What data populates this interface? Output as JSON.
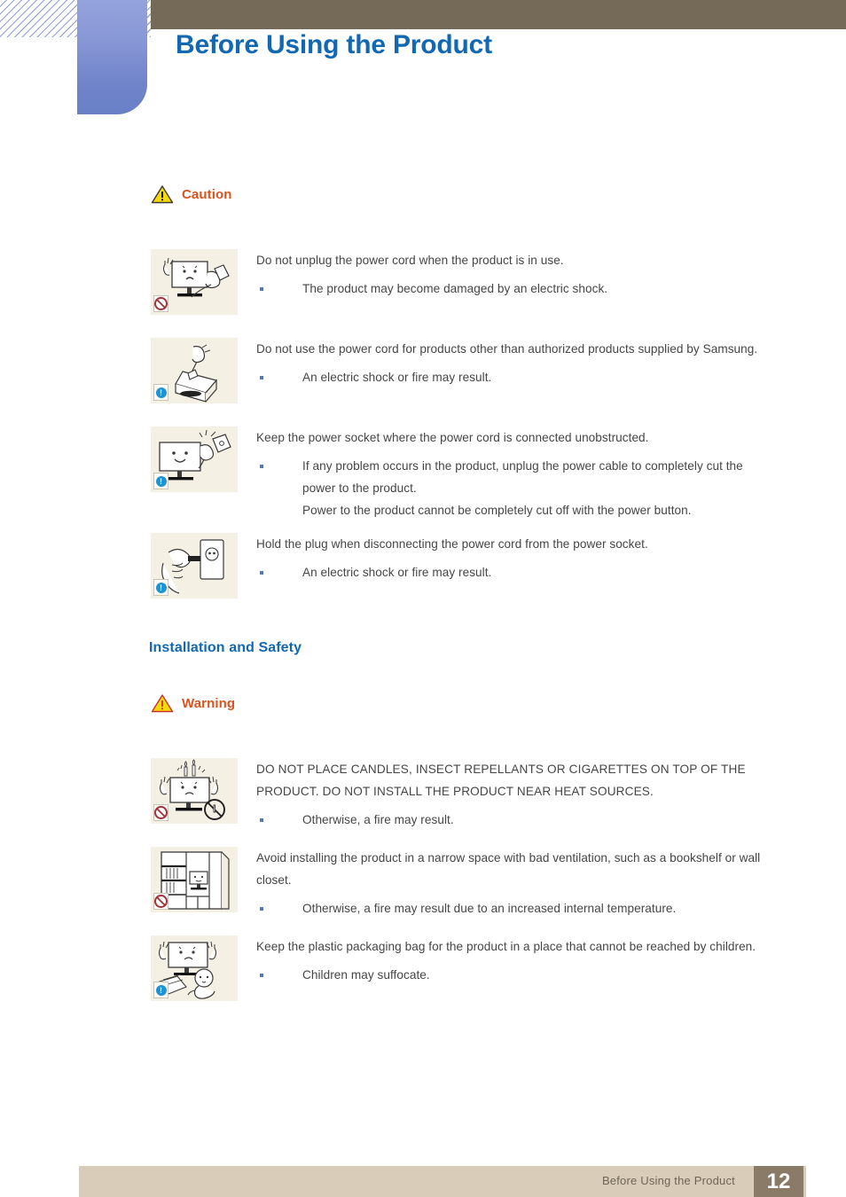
{
  "header": {
    "title": "Before Using the Product"
  },
  "notices": {
    "caution_label": "Caution",
    "warning_label": "Warning"
  },
  "sections": [
    {
      "heading": null,
      "notice": "Caution",
      "items": [
        {
          "illustration": "monitor-unplug-cord-illustration",
          "badge": "prohibition-icon",
          "lead": "Do not unplug the power cord when the product is in use.",
          "bullets": [
            "The product may become damaged by an electric shock."
          ]
        },
        {
          "illustration": "samsung-box-power-cord-illustration",
          "badge": "info-icon",
          "lead": "Do not use the power cord for products other than authorized products supplied by Samsung.",
          "bullets": [
            "An electric shock or fire may result."
          ]
        },
        {
          "illustration": "monitor-power-socket-illustration",
          "badge": "info-icon",
          "lead": "Keep the power socket where the power cord is connected unobstructed.",
          "bullets": [
            "If any problem occurs in the product, unplug the power cable to completely cut the power to the product.",
            "Power to the product cannot be completely cut off with the power button."
          ]
        },
        {
          "illustration": "hand-holding-plug-illustration",
          "badge": "info-icon",
          "lead": "Hold the plug when disconnecting the power cord from the power socket.",
          "bullets": [
            "An electric shock or fire may result."
          ]
        }
      ]
    },
    {
      "heading": "Installation and Safety",
      "notice": "Warning",
      "items": [
        {
          "illustration": "monitor-candles-heat-illustration",
          "badge": "prohibition-icon",
          "lead": "DO NOT PLACE CANDLES, INSECT REPELLANTS OR CIGARETTES ON TOP OF THE PRODUCT. DO NOT INSTALL THE PRODUCT NEAR HEAT SOURCES.",
          "bullets": [
            "Otherwise, a fire may result."
          ]
        },
        {
          "illustration": "monitor-bookshelf-illustration",
          "badge": "prohibition-icon",
          "lead": "Avoid installing the product in a narrow space with bad ventilation, such as a bookshelf or wall closet.",
          "bullets": [
            "Otherwise, a fire may result due to an increased internal temperature."
          ]
        },
        {
          "illustration": "plastic-bag-child-illustration",
          "badge": "info-icon",
          "lead": "Keep the plastic packaging bag for the product in a place that cannot be reached by children.",
          "bullets": [
            "Children may suffocate."
          ]
        }
      ]
    }
  ],
  "body": {
    "b1_lead": "Do not unplug the power cord when the product is in use.",
    "b1_bullet1": "The product may become damaged by an electric shock.",
    "b2_lead": "Do not use the power cord for products other than authorized products supplied by Samsung.",
    "b2_bullet1": "An electric shock or fire may result.",
    "b3_lead": "Keep the power socket where the power cord is connected unobstructed.",
    "b3_bullet1": "If any problem occurs in the product, unplug the power cable to completely cut the power to the product.",
    "b3_bullet2": "Power to the product cannot be completely cut off with the power button.",
    "b4_lead": "Hold the plug when disconnecting the power cord from the power socket.",
    "b4_bullet1": "An electric shock or fire may result.",
    "section2_heading": "Installation and Safety",
    "b5_lead": "DO NOT PLACE CANDLES, INSECT REPELLANTS OR CIGARETTES ON TOP OF THE PRODUCT. DO NOT INSTALL THE PRODUCT NEAR HEAT SOURCES.",
    "b5_bullet1": "Otherwise, a fire may result.",
    "b6_lead": "Avoid installing the product in a narrow space with bad ventilation, such as a bookshelf or wall closet.",
    "b6_bullet1": "Otherwise, a fire may result due to an increased internal temperature.",
    "b7_lead": "Keep the plastic packaging bag for the product in a place that cannot be reached by children.",
    "b7_bullet1": "Children may suffocate."
  },
  "footer": {
    "label": "Before Using the Product",
    "page_number": "12"
  },
  "colors": {
    "title_blue": "#1268b3",
    "notice_orange": "#d9541e",
    "header_brown": "#756957",
    "tab_blue": "#6f83c9",
    "footer_tan": "#d9cdba",
    "page_box_brown": "#8a7a68",
    "body_text": "#464646",
    "bullet_blue": "#5577bb",
    "thumb_bg": "#f5f0e4"
  }
}
